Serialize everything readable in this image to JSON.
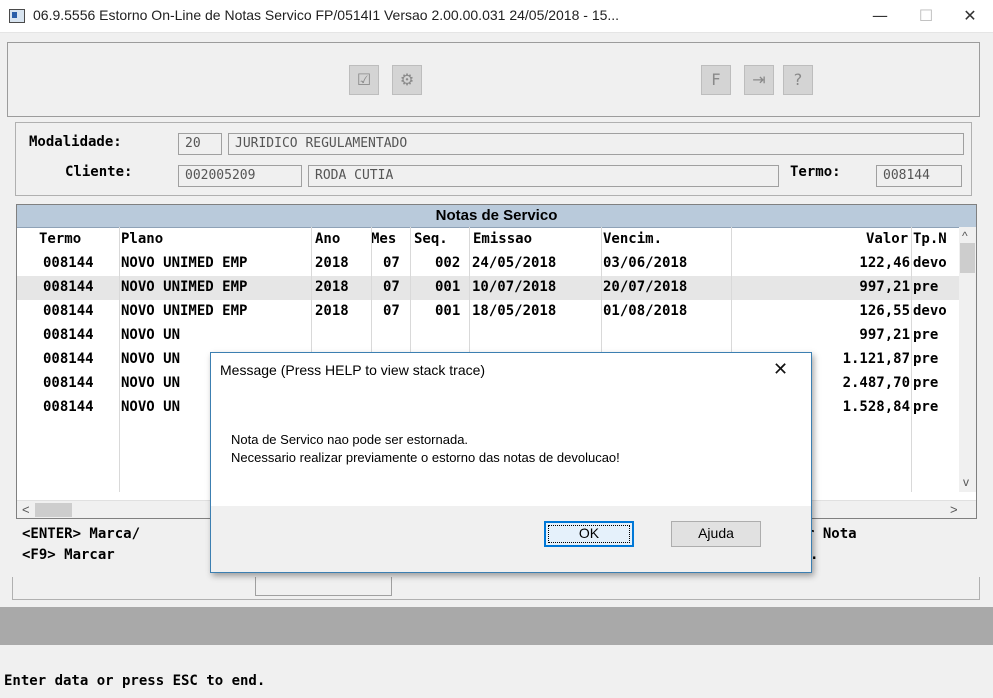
{
  "window": {
    "title": "06.9.5556 Estorno On-Line de Notas Servico FP/0514I1 Versao 2.00.00.031 24/05/2018 - 15...",
    "minimize_glyph": "—",
    "maximize_glyph": "☐",
    "close_glyph": "✕"
  },
  "toolbar": {
    "icons": [
      "list-check-icon",
      "gears-icon",
      "exit-form-icon",
      "door-exit-icon",
      "help-icon"
    ]
  },
  "header": {
    "modalidade_label": "Modalidade:",
    "modalidade_code": "20",
    "modalidade_desc": "JURIDICO REGULAMENTADO",
    "cliente_label": "Cliente:",
    "cliente_code": "002005209",
    "cliente_name": "RODA CUTIA",
    "termo_label": "Termo:",
    "termo_value": "008144"
  },
  "browse": {
    "title": "Notas de Servico",
    "columns": [
      "Termo",
      "Plano",
      "Ano",
      "Mes",
      "Seq.",
      "Emissao",
      "Vencim.",
      "Valor",
      "Tp.N"
    ],
    "rows": [
      [
        "008144",
        "NOVO UNIMED EMP",
        "2018",
        "07",
        "002",
        "24/05/2018",
        "03/06/2018",
        "122,46",
        "devo"
      ],
      [
        "008144",
        "NOVO UNIMED EMP",
        "2018",
        "07",
        "001",
        "10/07/2018",
        "20/07/2018",
        "997,21",
        "pre"
      ],
      [
        "008144",
        "NOVO UNIMED EMP",
        "2018",
        "07",
        "001",
        "18/05/2018",
        "01/08/2018",
        "126,55",
        "devo"
      ],
      [
        "008144",
        "NOVO UN",
        "",
        "",
        "",
        "",
        "",
        "997,21",
        "pre"
      ],
      [
        "008144",
        "NOVO UN",
        "",
        "",
        "",
        "",
        "",
        "1.121,87",
        "pre"
      ],
      [
        "008144",
        "NOVO UN",
        "",
        "",
        "",
        "",
        "",
        "2.487,70",
        "pre"
      ],
      [
        "008144",
        "NOVO UN",
        "",
        "",
        "",
        "",
        "",
        "1.528,84",
        "pre"
      ]
    ],
    "selected_row": 1,
    "scroll_up_glyph": "^",
    "scroll_down_glyph": "v",
    "scroll_left_glyph": "<",
    "scroll_right_glyph": ">"
  },
  "footer": {
    "line1_left": "<ENTER> Marca/",
    "line1_right": "r Nota",
    "line2_left": "<F9>   Marcar",
    "line2_right": "."
  },
  "status_bar": {
    "text": "Enter data or press ESC to end."
  },
  "dialog": {
    "title": "Message (Press HELP to view stack trace)",
    "close_glyph": "✕",
    "message_line1": "Nota de Servico nao pode ser estornada.",
    "message_line2": "Necessario realizar previamente o estorno das notas de devolucao!",
    "ok_label": "OK",
    "help_label": "Ajuda"
  }
}
